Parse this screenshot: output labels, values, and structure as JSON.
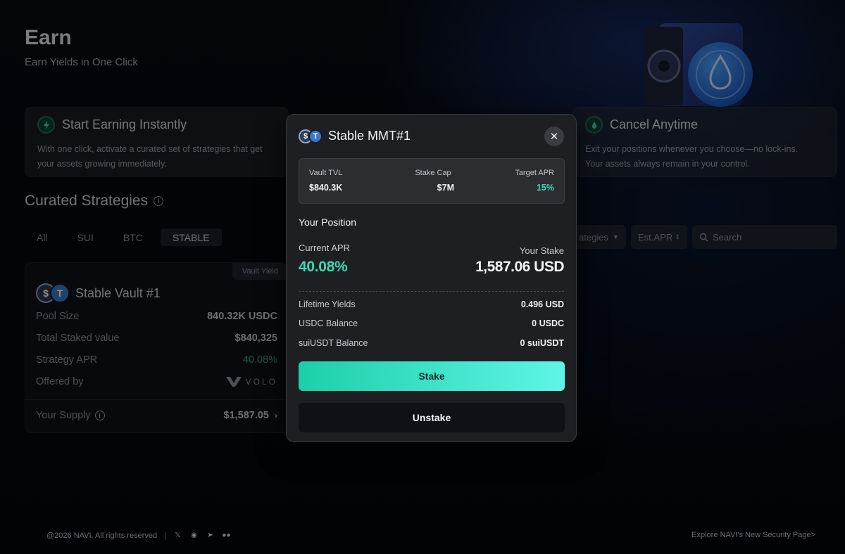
{
  "page": {
    "title": "Earn",
    "subtitle": "Earn Yields in One Click"
  },
  "features": [
    {
      "title": "Start Earning Instantly",
      "desc_line1": "With one click, activate a curated set of strategies that get",
      "desc_line2": "your assets growing immediately.",
      "icon": "lightning-icon"
    },
    {
      "title": "Cancel Anytime",
      "desc_line1": "Exit your positions whenever you choose—no lock-ins.",
      "desc_line2": "Your assets always remain in your control.",
      "icon": "drop-icon"
    }
  ],
  "strategies": {
    "title": "Curated Strategies",
    "tabs": [
      "All",
      "SUI",
      "BTC",
      "STABLE"
    ],
    "active_tab": "STABLE",
    "filter_strategies": "ategies",
    "filter_sort": "Est.APR",
    "search_placeholder": "Search"
  },
  "card": {
    "tag": "Vault Yield",
    "title": "Stable Vault #1",
    "rows": [
      {
        "label": "Pool Size",
        "value": "840.32K USDC"
      },
      {
        "label": "Total Staked value",
        "value": "$840,325"
      },
      {
        "label": "Strategy APR",
        "value": "40.08%"
      },
      {
        "label": "Offered by",
        "value": "VOLO"
      }
    ],
    "supply_label": "Your Supply",
    "supply_value": "$1,587.05"
  },
  "modal": {
    "title": "Stable MMT#1",
    "stats": [
      {
        "label": "Vault TVL",
        "value": "$840.3K"
      },
      {
        "label": "Stake Cap",
        "value": "$7M"
      },
      {
        "label": "Target APR",
        "value": "15%"
      }
    ],
    "position_title": "Your Position",
    "current_apr_label": "Current APR",
    "current_apr_value": "40.08%",
    "your_stake_label": "Your Stake",
    "your_stake_value": "1,587.06 USD",
    "rows": [
      {
        "label": "Lifetime Yields",
        "value": "0.496 USD"
      },
      {
        "label": "USDC Balance",
        "value": "0 USDC"
      },
      {
        "label": "suiUSDT Balance",
        "value": "0 suiUSDT"
      }
    ],
    "stake_button": "Stake",
    "unstake_button": "Unstake"
  },
  "footer": {
    "copyright": "@2026 NAVI. All rights reserved",
    "link": "Explore NAVI's New Security Page>"
  },
  "colors": {
    "accent": "#3fd9b4",
    "green": "#2fa07c"
  }
}
